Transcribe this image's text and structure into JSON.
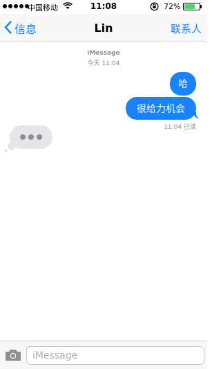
{
  "status_bar": {
    "carrier": "中国移动",
    "time": "11:08",
    "battery_percent": "72%",
    "battery_level": 0.72,
    "icons": [
      "signal-dots",
      "wifi-icon",
      "rotation-lock-icon",
      "battery-icon"
    ]
  },
  "nav": {
    "back_label": "信息",
    "title": "Lin",
    "contacts_label": "联系人"
  },
  "conversation": {
    "service_label": "iMessage",
    "timestamp": "今天 11:04",
    "messages": [
      {
        "text": "哈",
        "direction": "outgoing"
      },
      {
        "text": "很给力机会",
        "direction": "outgoing"
      }
    ],
    "read_receipt": "11:04 已读",
    "typing_indicator": "•••"
  },
  "input_bar": {
    "placeholder": "iMessage",
    "value": "",
    "camera_icon": "camera-icon"
  },
  "colors": {
    "accent": "#1a82fb",
    "bubble_incoming": "#e5e5ea",
    "meta_text": "#8e8e93",
    "battery": "#4cd964"
  }
}
